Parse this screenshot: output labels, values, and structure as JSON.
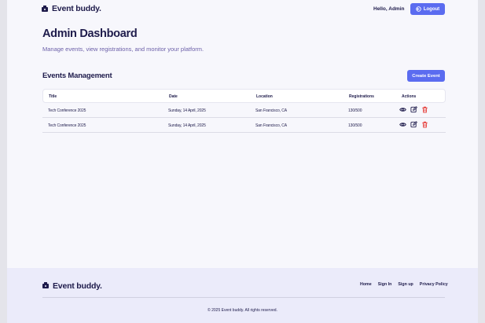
{
  "header": {
    "brand": "Event buddy.",
    "greeting": "Hello, Admin",
    "logout_label": "Logout"
  },
  "main": {
    "title": "Admin Dashboard",
    "subtitle": "Manage events, view registrations, and monitor your platform.",
    "section_title": "Events Management",
    "create_label": "Create Event"
  },
  "table": {
    "columns": [
      "Title",
      "Date",
      "Location",
      "Registrations",
      "Actions"
    ],
    "rows": [
      {
        "title": "Tech Conference 2025",
        "date": "Sunday, 14 April, 2025",
        "location": "San Francisco, CA",
        "registrations": "130/500"
      },
      {
        "title": "Tech Conference 2025",
        "date": "Sunday, 14 April, 2025",
        "location": "San Francisco, CA",
        "registrations": "130/500"
      }
    ],
    "action_icons": [
      "eye-icon",
      "edit-icon",
      "trash-icon"
    ]
  },
  "footer": {
    "brand": "Event buddy.",
    "links": [
      "Home",
      "Sign In",
      "Sign up",
      "Privacy Policy"
    ],
    "copyright": "© 2025 Event buddy. All rights reserved."
  },
  "colors": {
    "accent": "#5b6cf0",
    "text": "#1e1b4b",
    "subtitle": "#6b5fa8",
    "delete": "#e53935",
    "footer_bg": "#ebebfa"
  }
}
